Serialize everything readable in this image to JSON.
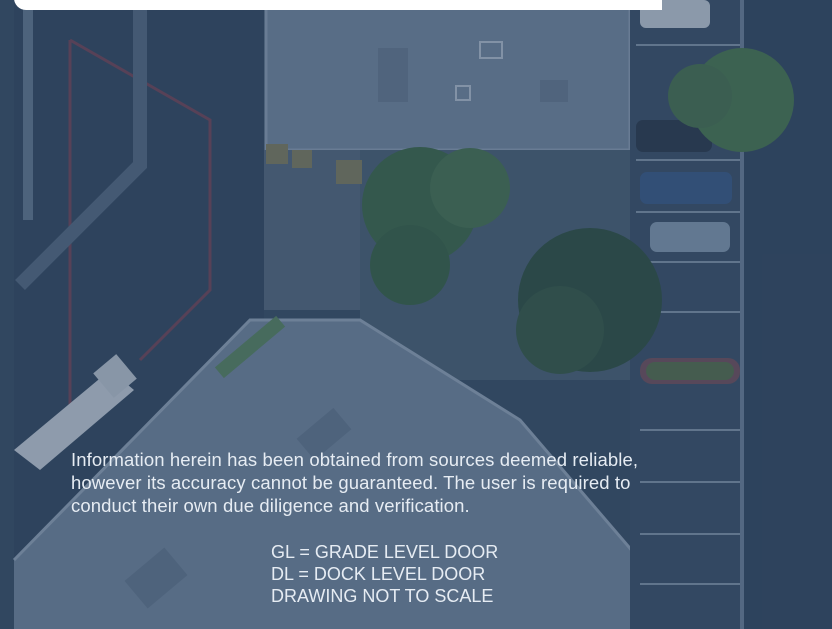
{
  "disclaimer": {
    "line1": "Information herein has been obtained from sources deemed reliable,",
    "line2": "however its accuracy cannot be guaranteed. The user is required to",
    "line3": "conduct their own due diligence and verification."
  },
  "legend": {
    "grade_level": "GL = GRADE LEVEL DOOR",
    "dock_level": "DL = DOCK LEVEL DOOR",
    "scale_note": "DRAWING NOT TO SCALE"
  },
  "colors": {
    "overlay": "#264062",
    "text": "#e6ecf3",
    "tree": "#3f6a3f"
  }
}
